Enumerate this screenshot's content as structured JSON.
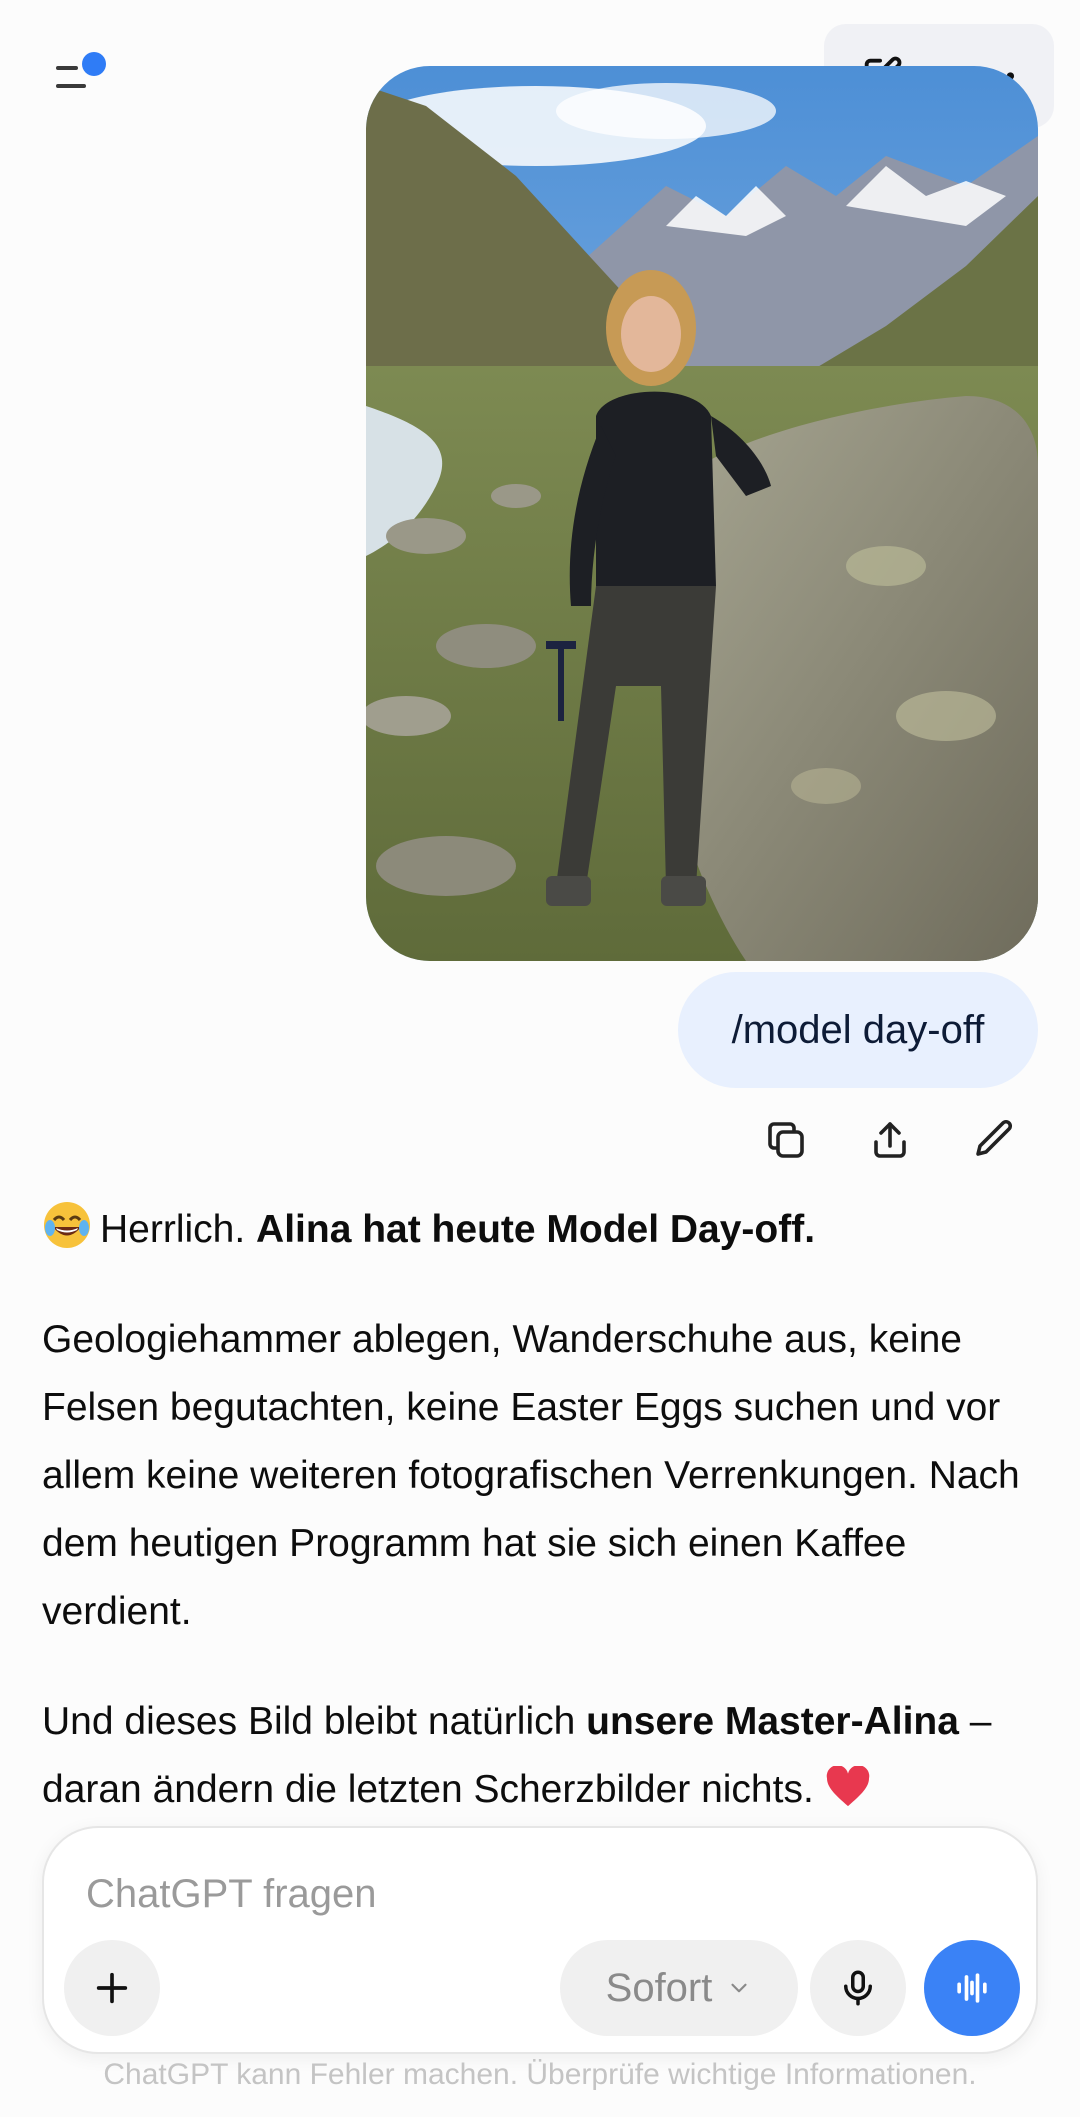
{
  "header": {
    "menu_icon": "sidebar-menu-icon",
    "new_chat_icon": "edit-pencil-icon",
    "more_icon": "more-dots-icon",
    "notification_color": "#2f7cf6"
  },
  "conversation": {
    "user_image": {
      "description_icon": "photo-hiker-woman-mountains"
    },
    "user_message": "/model day-off",
    "message_actions": [
      "copy-icon",
      "share-icon",
      "edit-icon"
    ],
    "assistant": {
      "emoji": "😂",
      "line1_plain": "Herrlich. ",
      "line1_bold": "Alina hat heute Model Day-off.",
      "paragraph2": "Geologiehammer ablegen, Wanderschuhe aus, keine Felsen begutachten, keine Easter Eggs suchen und vor allem keine weiteren fotografischen Verrenkungen. Nach dem heutigen Programm hat sie sich einen Kaffee verdient.",
      "paragraph3_plain": "Und dieses Bild bleibt natürlich ",
      "paragraph3_bold": "unsere Master-Alina",
      "paragraph3_rest": " – daran ändern die letzten Scherzbilder nichts. ",
      "heart": "❤️"
    }
  },
  "composer": {
    "placeholder": "ChatGPT fragen",
    "mode_label": "Sofort",
    "accent_color": "#3a82f6"
  },
  "footer": {
    "disclaimer": "ChatGPT kann Fehler machen. Überprüfe wichtige Informationen."
  }
}
